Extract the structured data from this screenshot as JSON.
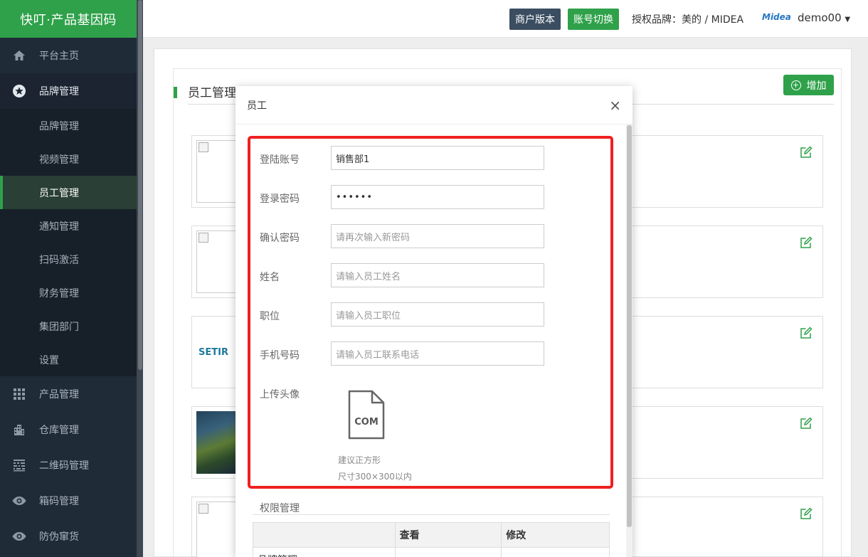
{
  "app": {
    "brand": "快叮·产品基因码"
  },
  "sidebar": {
    "items": [
      {
        "label": "平台主页",
        "icon": "home-icon"
      },
      {
        "label": "品牌管理",
        "icon": "star-icon"
      }
    ],
    "sub_items": [
      {
        "label": "品牌管理"
      },
      {
        "label": "视频管理"
      },
      {
        "label": "员工管理",
        "active": true
      },
      {
        "label": "通知管理"
      },
      {
        "label": "扫码激活"
      },
      {
        "label": "财务管理"
      },
      {
        "label": "集团部门"
      },
      {
        "label": "设置"
      }
    ],
    "items_after": [
      {
        "label": "产品管理",
        "icon": "grid-icon"
      },
      {
        "label": "仓库管理",
        "icon": "building-icon"
      },
      {
        "label": "二维码管理",
        "icon": "qrcode-icon"
      },
      {
        "label": "箱码管理",
        "icon": "eye-icon"
      },
      {
        "label": "防伪窜货",
        "icon": "eye-icon"
      }
    ]
  },
  "topbar": {
    "merchant_version": "商户版本",
    "account_switch": "账号切换",
    "authorized_brand": "授权品牌：美的 / MIDEA",
    "brand_logo": "Midea",
    "username": "demo00"
  },
  "page": {
    "title": "员工管理",
    "add_button": "增加",
    "card_brand_text": "SETIR"
  },
  "modal": {
    "title": "员工",
    "close": "×",
    "fields": {
      "account": {
        "label": "登陆账号",
        "value": "销售部1"
      },
      "password": {
        "label": "登录密码",
        "value": "••••••"
      },
      "confirm": {
        "label": "确认密码",
        "placeholder": "请再次输入新密码"
      },
      "name": {
        "label": "姓名",
        "placeholder": "请输入员工姓名"
      },
      "position": {
        "label": "职位",
        "placeholder": "请输入员工职位"
      },
      "phone": {
        "label": "手机号码",
        "placeholder": "请输入员工联系电话"
      },
      "avatar": {
        "label": "上传头像",
        "file_ext": "COM"
      }
    },
    "avatar_hint_1": "建议正方形",
    "avatar_hint_2": "尺寸300×300以内",
    "permissions": {
      "title": "权限管理",
      "columns": [
        "",
        "查看",
        "修改"
      ],
      "first_row": "品牌管理"
    }
  },
  "colors": {
    "accent": "#2fa14a",
    "sidebar": "#202b38",
    "highlight": "#ef2020"
  }
}
